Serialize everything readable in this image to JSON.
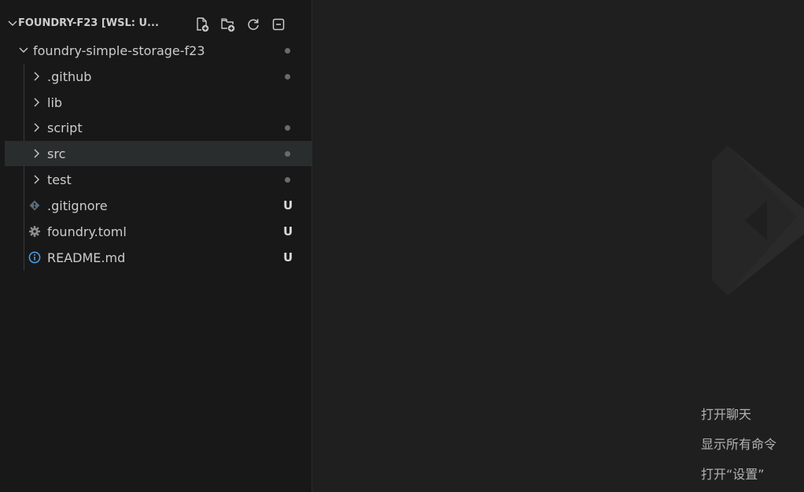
{
  "explorer": {
    "section_title": "FOUNDRY-F23 [WSL: U...",
    "actions": [
      {
        "name": "new-file-icon"
      },
      {
        "name": "new-folder-icon"
      },
      {
        "name": "refresh-icon"
      },
      {
        "name": "collapse-all-icon"
      }
    ],
    "root_folder": {
      "label": "foundry-simple-storage-f23",
      "status": "dot"
    },
    "items": [
      {
        "label": ".github",
        "type": "folder",
        "status": "dot"
      },
      {
        "label": "lib",
        "type": "folder",
        "status": ""
      },
      {
        "label": "script",
        "type": "folder",
        "status": "dot"
      },
      {
        "label": "src",
        "type": "folder",
        "status": "dot",
        "selected": true
      },
      {
        "label": "test",
        "type": "folder",
        "status": "dot"
      },
      {
        "label": ".gitignore",
        "type": "file",
        "icon": "git-icon",
        "status": "U"
      },
      {
        "label": "foundry.toml",
        "type": "file",
        "icon": "gear-icon",
        "status": "U"
      },
      {
        "label": "README.md",
        "type": "file",
        "icon": "info-icon",
        "status": "U"
      }
    ]
  },
  "editor": {
    "hints": [
      {
        "label": "打开聊天"
      },
      {
        "label": "显示所有命令"
      },
      {
        "label": "打开“设置”"
      }
    ]
  },
  "colors": {
    "sidebar_bg": "#181818",
    "editor_bg": "#1f1f1f",
    "selected_row": "#2a2d2e",
    "text": "#cccccc",
    "modified_dot": "#6b6b6b",
    "gear": "#8c8c8c",
    "info": "#4fa0e8",
    "git": "#5a6b7a"
  }
}
